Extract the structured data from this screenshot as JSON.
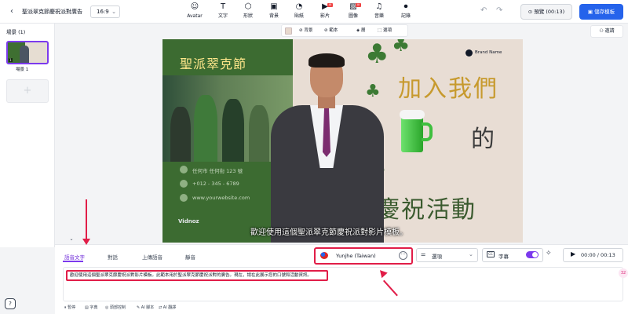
{
  "topbar": {
    "project_title": "聖派翠克節慶祝派對廣告",
    "aspect_ratio": "16:9",
    "tools": [
      {
        "id": "avatar",
        "label": "Avatar",
        "icon": "avatar-icon",
        "glyph": "☺",
        "badge": ""
      },
      {
        "id": "text",
        "label": "文字",
        "icon": "text-icon",
        "glyph": "T",
        "badge": ""
      },
      {
        "id": "shape",
        "label": "形狀",
        "icon": "shape-icon",
        "glyph": "⬡",
        "badge": ""
      },
      {
        "id": "background",
        "label": "背景",
        "icon": "background-icon",
        "glyph": "▣",
        "badge": ""
      },
      {
        "id": "sticker",
        "label": "貼紙",
        "icon": "sticker-icon",
        "glyph": "◔",
        "badge": ""
      },
      {
        "id": "video",
        "label": "影片",
        "icon": "video-icon",
        "glyph": "▶",
        "badge": "AI"
      },
      {
        "id": "image",
        "label": "圖像",
        "icon": "image-icon",
        "glyph": "▨",
        "badge": "AI"
      },
      {
        "id": "music",
        "label": "音樂",
        "icon": "music-icon",
        "glyph": "♫",
        "badge": ""
      },
      {
        "id": "record",
        "label": "記錄",
        "icon": "record-icon",
        "glyph": "⏺",
        "badge": ""
      }
    ],
    "preview_label": "預覽 (00:13)",
    "save_label": "儲存模板"
  },
  "scenes": {
    "header": "場景 (1)",
    "thumb_number": "1",
    "scene_label": "場景 1",
    "add_glyph": "+"
  },
  "canvas_toolbar": {
    "background": "背景",
    "template": "範本",
    "layer": "層",
    "select": "選項"
  },
  "invite_label": "邀請",
  "canvas": {
    "title": "聖派翠克節",
    "address": "任何市 任何街 123 號",
    "phone": "+012 - 345 - 6789",
    "website": "www.yourwebsite.com",
    "watermark": "Vidnoz",
    "brand": "Brand Name",
    "headline_1": "加入我們",
    "headline_2": "的",
    "headline_3": "慶祝活動",
    "subtitle": "歡迎使用這個聖派翠克節慶祝派對影片模板。"
  },
  "bottom": {
    "tabs": [
      "語音文字",
      "對話",
      "上傳語音",
      "靜音"
    ],
    "voice_name": "Yunjhe (Taiwan)",
    "options_label": "選項",
    "subtitle_label": "字幕",
    "subtitle_icon_text": "CC",
    "play_time": "00:00 / 00:13",
    "script_text": "歡迎使用這個聖派翠克節慶祝派對影片模板。此範本用於聖派翠克節慶祝派對的廣告。現在，請在此展示您的口號和活動資訊。",
    "chips": [
      {
        "label": "暫停",
        "glyph": "⏸"
      },
      {
        "label": "字典",
        "glyph": "▤"
      },
      {
        "label": "頭部控制",
        "glyph": "◎"
      },
      {
        "label": "AI 腳本",
        "glyph": "✎"
      },
      {
        "label": "AI 翻譯",
        "glyph": "⇄"
      }
    ],
    "side_badge": "32"
  },
  "colors": {
    "accent": "#7c3aed",
    "primary_button": "#2563eb",
    "annotation": "#e11d48",
    "canvas_green": "#3c6b31",
    "canvas_cream": "#e8ddd4"
  }
}
